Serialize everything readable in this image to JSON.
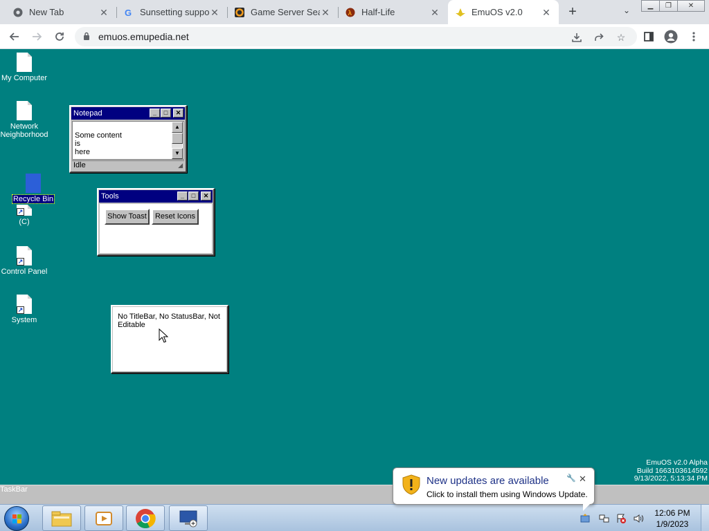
{
  "browser": {
    "tabs": [
      {
        "title": "New Tab",
        "favicon": "chrome-icon"
      },
      {
        "title": "Sunsetting suppo",
        "favicon": "google-icon"
      },
      {
        "title": "Game Server Sea",
        "favicon": "gametracker-icon"
      },
      {
        "title": "Half-Life",
        "favicon": "half-life-icon"
      },
      {
        "title": "EmuOS v2.0",
        "favicon": "emuos-icon",
        "active": true
      }
    ],
    "address": "emuos.emupedia.net"
  },
  "desktop": {
    "background_color": "#008080",
    "icons": [
      {
        "label": "My Computer"
      },
      {
        "label": "Network Neighborhood"
      },
      {
        "label": "Recycle Bin",
        "selected": true
      },
      {
        "label": "(C)"
      },
      {
        "label": "Control Panel"
      },
      {
        "label": "System"
      }
    ],
    "build_info": [
      "EmuOS v2.0 Alpha",
      "Build 1663103614592",
      "9/13/2022, 5:13:34 PM"
    ]
  },
  "windows": {
    "notepad": {
      "title": "Notepad",
      "content_lines": [
        "Some content",
        "is",
        "here"
      ],
      "status": "Idle"
    },
    "tools": {
      "title": "Tools",
      "buttons": [
        "Show Toast",
        "Reset Icons"
      ]
    },
    "plain": {
      "content": "No TitleBar, No StatusBar, Not Editable"
    }
  },
  "taskbar_strip": {
    "label": "TaskBar"
  },
  "win7_taskbar": {
    "apps": [
      "explorer-icon",
      "media-player-icon",
      "chrome-icon",
      "remote-desktop-icon"
    ],
    "clock_time": "12:06 PM",
    "clock_date": "1/9/2023"
  },
  "notification": {
    "title": "New updates are available",
    "message": "Click to install them using Windows Update."
  }
}
